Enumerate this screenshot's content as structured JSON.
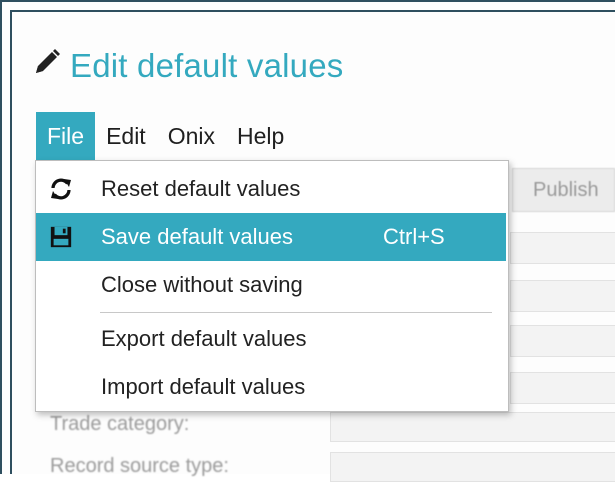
{
  "dialog": {
    "title": "Edit default values",
    "title_icon": "pencil-icon"
  },
  "menubar": {
    "items": [
      {
        "label": "File",
        "active": true
      },
      {
        "label": "Edit",
        "active": false
      },
      {
        "label": "Onix",
        "active": false
      },
      {
        "label": "Help",
        "active": false
      }
    ]
  },
  "file_menu": {
    "items": [
      {
        "label": "Reset default values",
        "icon": "refresh-icon",
        "shortcut": ""
      },
      {
        "label": "Save default values",
        "icon": "save-icon",
        "shortcut": "Ctrl+S",
        "highlighted": true
      },
      {
        "label": "Close without saving",
        "icon": "",
        "shortcut": ""
      },
      {
        "label": "Export default values",
        "icon": "",
        "shortcut": ""
      },
      {
        "label": "Import default values",
        "icon": "",
        "shortcut": ""
      }
    ]
  },
  "background": {
    "tab_label": "Publish",
    "field_labels": [
      "Trade category:",
      "Record source type:"
    ]
  },
  "colors": {
    "accent": "#34a9bf",
    "frame": "#2e4f5f"
  }
}
